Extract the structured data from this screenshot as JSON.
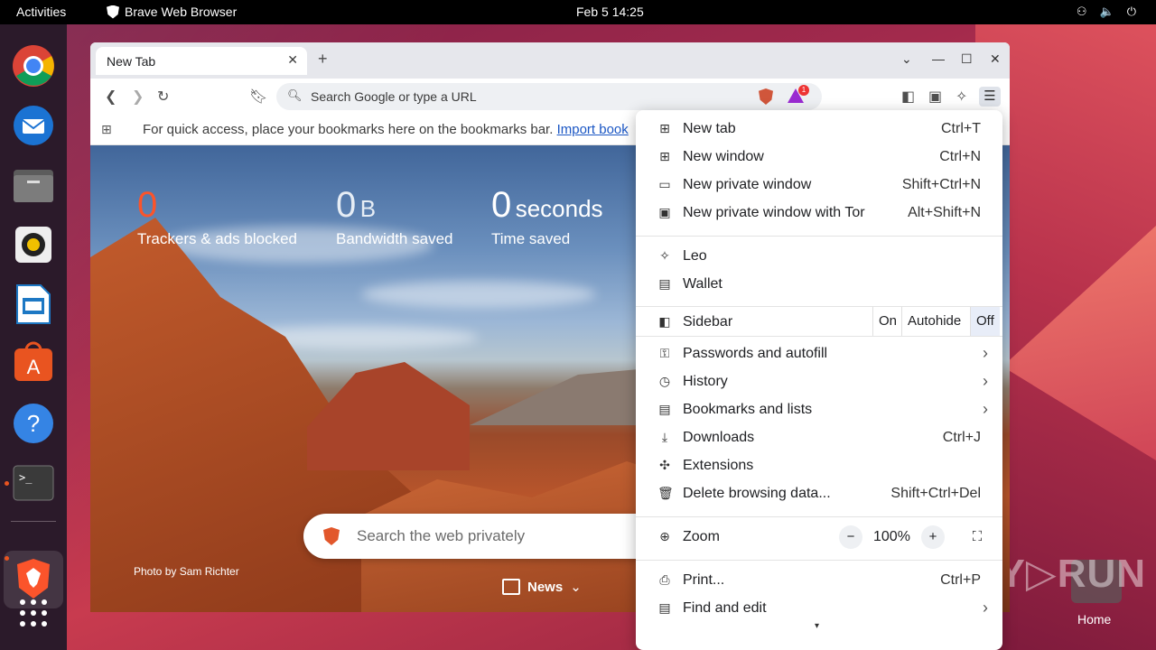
{
  "topbar": {
    "activities": "Activities",
    "app_name": "Brave Web Browser",
    "clock": "Feb 5  14:25",
    "sys_icons": [
      "network-icon",
      "volume-icon",
      "power-icon"
    ]
  },
  "dock": {
    "items": [
      "chrome",
      "thunderbird",
      "files",
      "rhythmbox",
      "writer",
      "app-center",
      "help",
      "terminal",
      "brave",
      "show-apps"
    ]
  },
  "browser": {
    "tab_title": "New Tab",
    "address_placeholder": "Search Google or type a URL",
    "rewards_badge": "1",
    "bookmarks_message": "For quick access, place your bookmarks here on the bookmarks bar.",
    "bookmarks_import": "Import book"
  },
  "ntp": {
    "stats": [
      {
        "value": "0",
        "unit": "",
        "label": "Trackers & ads blocked",
        "color": "#fb542b"
      },
      {
        "value": "0",
        "unit": "B",
        "label": "Bandwidth saved",
        "color": "#ffffff"
      },
      {
        "value": "0",
        "unit": "seconds",
        "label": "Time saved",
        "color": "#ffffff"
      }
    ],
    "search_placeholder": "Search the web privately",
    "photo_credit": "Photo by Sam Richter",
    "news_label": "News"
  },
  "menu": {
    "new_tab": {
      "label": "New tab",
      "shortcut": "Ctrl+T"
    },
    "new_window": {
      "label": "New window",
      "shortcut": "Ctrl+N"
    },
    "new_private": {
      "label": "New private window",
      "shortcut": "Shift+Ctrl+N"
    },
    "new_private_tor": {
      "label": "New private window with Tor",
      "shortcut": "Alt+Shift+N"
    },
    "leo": {
      "label": "Leo"
    },
    "wallet": {
      "label": "Wallet"
    },
    "sidebar": {
      "label": "Sidebar",
      "options": [
        "On",
        "Autohide",
        "Off"
      ],
      "selected": "Off"
    },
    "passwords": {
      "label": "Passwords and autofill"
    },
    "history": {
      "label": "History"
    },
    "bookmarks": {
      "label": "Bookmarks and lists"
    },
    "downloads": {
      "label": "Downloads",
      "shortcut": "Ctrl+J"
    },
    "extensions": {
      "label": "Extensions"
    },
    "delete_data": {
      "label": "Delete browsing data...",
      "shortcut": "Shift+Ctrl+Del"
    },
    "zoom": {
      "label": "Zoom",
      "value": "100%",
      "minus": "−",
      "plus": "+"
    },
    "print": {
      "label": "Print...",
      "shortcut": "Ctrl+P"
    },
    "find_edit": {
      "label": "Find and edit"
    }
  },
  "desktop": {
    "home_label": "Home",
    "watermark": "ANY.RUN"
  },
  "colors": {
    "accent": "#fb542b",
    "menu_selected": "#e8edf8",
    "dock_bg": "#2b1a2a"
  }
}
